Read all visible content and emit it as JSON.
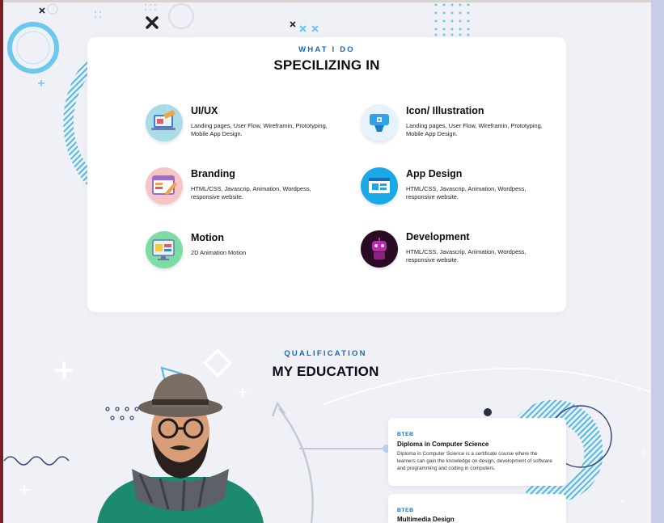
{
  "services_section": {
    "eyebrow": "WHAT I DO",
    "heading": "SPECILIZING IN",
    "items": [
      {
        "title": "UI/UX",
        "description": "Landing pages, User Flow, Wireframin, Prototyping, Mobile App Design.",
        "icon": "laptop-design-icon"
      },
      {
        "title": "Icon/ Illustration",
        "description": "Landing pages, User Flow, Wireframin, Prototyping, Mobile App Design.",
        "icon": "icon-illustration-icon"
      },
      {
        "title": "Branding",
        "description": "HTML/CSS, Javascrip, Animation, Wordpess, responsive website.",
        "icon": "branding-icon"
      },
      {
        "title": "App Design",
        "description": "HTML/CSS, Javascrip, Animation, Wordpess, responsive website.",
        "icon": "app-design-icon"
      },
      {
        "title": "Motion",
        "description": "2D Animation Motion",
        "icon": "motion-monitor-icon"
      },
      {
        "title": "Development",
        "description": "HTML/CSS, Javascrip, Animation, Wordpess, responsive website.",
        "icon": "development-robot-icon"
      }
    ]
  },
  "education_section": {
    "eyebrow": "QUALIFICATION",
    "heading": "MY EDUCATION",
    "entries": [
      {
        "institution": "BTEB",
        "title": "Diploma in Computer Science",
        "description": "Diploma in Computer Science is a certificate course where the learners can gain the knowledge on design, development of software and programming and coding in computers."
      },
      {
        "institution": "BTEB",
        "title": "Multimedia Design",
        "description": ""
      }
    ]
  },
  "colors": {
    "accent_blue": "#1b68b0",
    "heading": "#0b0b14",
    "stripe_cyan": "#4cb9e6",
    "background": "#f0f1f7"
  }
}
